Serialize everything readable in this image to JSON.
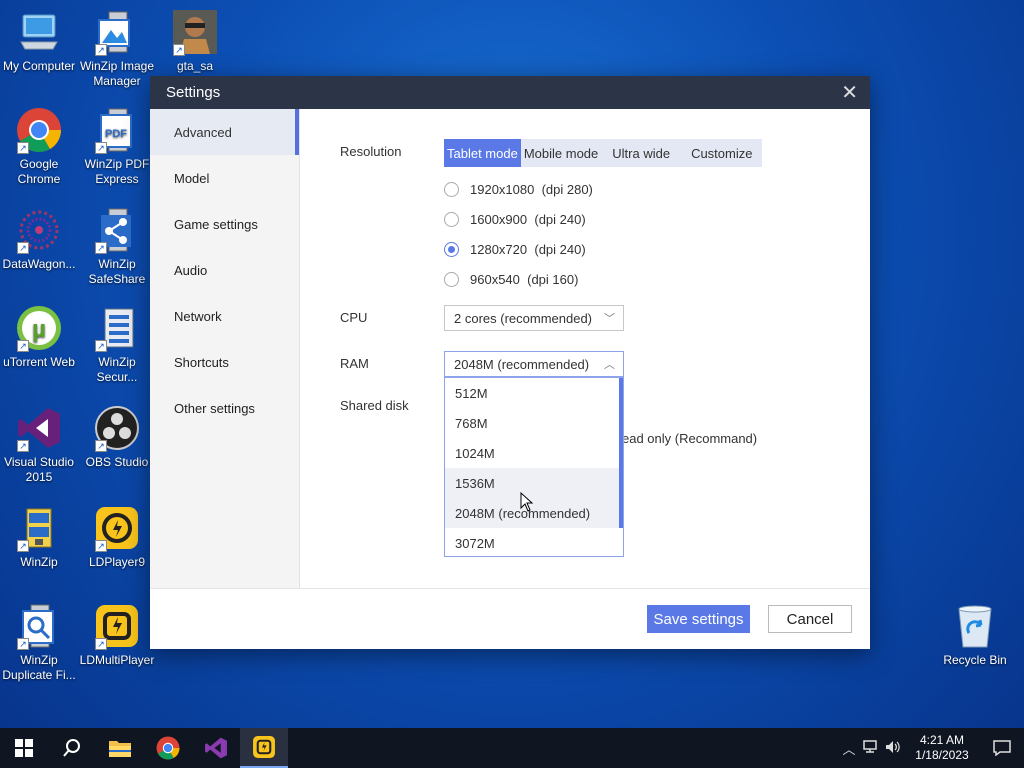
{
  "desktop": {
    "icons": [
      {
        "label": "My Computer",
        "icon": "computer-icon"
      },
      {
        "label": "WinZip Image Manager",
        "icon": "winzip-image-manager-icon"
      },
      {
        "label": "gta_sa",
        "icon": "gta-sa-icon"
      },
      {
        "label": "Google Chrome",
        "icon": "chrome-icon"
      },
      {
        "label": "WinZip PDF Express",
        "icon": "winzip-pdf-icon"
      },
      {
        "label": "DataWagon...",
        "icon": "datawagon-icon"
      },
      {
        "label": "WinZip SafeShare",
        "icon": "winzip-safeshare-icon"
      },
      {
        "label": "uTorrent Web",
        "icon": "utorrent-icon"
      },
      {
        "label": "WinZip Secur...",
        "icon": "winzip-secure-icon"
      },
      {
        "label": "Visual Studio 2015",
        "icon": "visual-studio-icon"
      },
      {
        "label": "OBS Studio",
        "icon": "obs-icon"
      },
      {
        "label": "WinZip",
        "icon": "winzip-icon"
      },
      {
        "label": "LDPlayer9",
        "icon": "ldplayer-icon"
      },
      {
        "label": "WinZip Duplicate Fi...",
        "icon": "winzip-duplicate-icon"
      },
      {
        "label": "LDMultiPlayer",
        "icon": "ldmultiplayer-icon"
      },
      {
        "label": "Recycle Bin",
        "icon": "recycle-bin-icon"
      }
    ]
  },
  "dialog": {
    "title": "Settings",
    "sidebar": [
      "Advanced",
      "Model",
      "Game settings",
      "Audio",
      "Network",
      "Shortcuts",
      "Other settings"
    ],
    "resolution": {
      "label": "Resolution",
      "tabs": [
        "Tablet mode",
        "Mobile mode",
        "Ultra wide",
        "Customize"
      ],
      "active_tab": "Tablet mode",
      "options": [
        {
          "res": "1920x1080",
          "dpi": "(dpi 280)",
          "checked": false
        },
        {
          "res": "1600x900",
          "dpi": "(dpi 240)",
          "checked": false
        },
        {
          "res": "1280x720",
          "dpi": "(dpi 240)",
          "checked": true
        },
        {
          "res": "960x540",
          "dpi": "(dpi 160)",
          "checked": false
        }
      ]
    },
    "cpu": {
      "label": "CPU",
      "value": "2 cores (recommended)"
    },
    "ram": {
      "label": "RAM",
      "value": "2048M (recommended)",
      "options": [
        "512M",
        "768M",
        "1024M",
        "1536M",
        "2048M (recommended)",
        "3072M"
      ],
      "hovered": "1536M"
    },
    "shared_disk": {
      "label": "Shared disk",
      "text": "ead only (Recommand)"
    },
    "save_label": "Save settings",
    "cancel_label": "Cancel"
  },
  "taskbar": {
    "time": "4:21 AM",
    "date": "1/18/2023"
  },
  "colors": {
    "accent": "#5a79e6",
    "header": "#2c3447",
    "taskbar": "#101621"
  }
}
